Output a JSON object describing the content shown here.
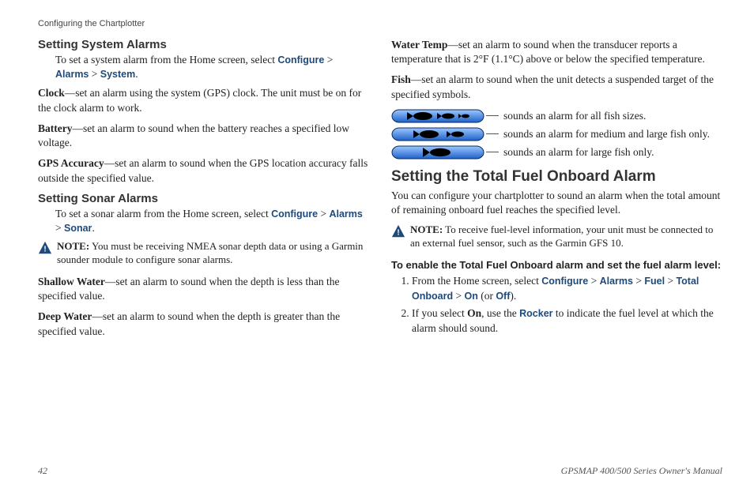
{
  "runningHead": "Configuring the Chartplotter",
  "left": {
    "h_sys": "Setting System Alarms",
    "sys_intro_pre": "To set a system alarm from the Home screen, select ",
    "sys_path": [
      "Configure",
      "Alarms",
      "System"
    ],
    "clock_term": "Clock",
    "clock_txt": "—set an alarm using the system (GPS) clock. The unit must be on for the clock alarm to work.",
    "batt_term": "Battery",
    "batt_txt": "—set an alarm to sound when the battery reaches a specified low voltage.",
    "gps_term": "GPS Accuracy",
    "gps_txt": "—set an alarm to sound when the GPS location accuracy falls outside the specified value.",
    "h_sonar": "Setting Sonar Alarms",
    "sonar_intro_pre": "To set a sonar alarm from the Home screen, select ",
    "sonar_path": [
      "Configure",
      "Alarms",
      "Sonar"
    ],
    "note_label": "NOTE:",
    "sonar_note": " You must be receiving NMEA sonar depth data or using a Garmin sounder module to configure sonar alarms.",
    "shallow_term": "Shallow Water",
    "shallow_txt": "—set an alarm to sound when the depth is less than the specified value.",
    "deep_term": "Deep Water",
    "deep_txt": "—set an alarm to sound when the depth is greater than the specified value."
  },
  "right": {
    "wt_term": "Water Temp",
    "wt_txt": "—set an alarm to sound when the transducer reports a temperature that is 2°F (1.1°C) above or below the specified temperature.",
    "fish_term": "Fish",
    "fish_txt": "—set an alarm to sound when the unit detects a suspended target of the specified symbols.",
    "fish_all": "sounds an alarm for all fish sizes.",
    "fish_ml": "sounds an alarm for medium and large fish only.",
    "fish_l": "sounds an alarm for large fish only.",
    "h_fuel": "Setting the Total Fuel Onboard Alarm",
    "fuel_intro": "You can configure your chartplotter to sound an alarm when the total amount of remaining onboard fuel reaches the specified level.",
    "note_label": "NOTE:",
    "fuel_note": " To receive fuel-level information, your unit must be connected to an external fuel sensor, such as the Garmin GFS 10.",
    "enable_head": "To enable the Total Fuel Onboard alarm and set the fuel alarm level:",
    "step1_pre": "From the Home screen, select ",
    "step1_path": [
      "Configure",
      "Alarms",
      "Fuel",
      "Total Onboard",
      "On"
    ],
    "step1_or": " (or ",
    "step1_off": "Off",
    "step1_end": ").",
    "step2_a": "If you select ",
    "step2_on": "On",
    "step2_b": ", use the ",
    "step2_rocker": "Rocker",
    "step2_c": " to indicate the fuel level at which the alarm should sound."
  },
  "footer": {
    "page": "42",
    "manual": "GPSMAP 400/500 Series Owner's Manual"
  }
}
